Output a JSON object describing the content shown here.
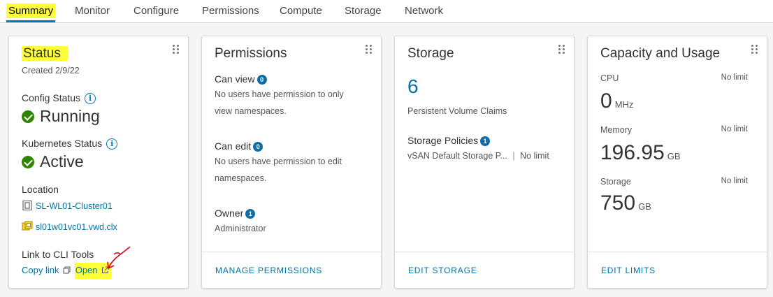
{
  "tabs": [
    "Summary",
    "Monitor",
    "Configure",
    "Permissions",
    "Compute",
    "Storage",
    "Network"
  ],
  "status": {
    "title": "Status",
    "created": "Created 2/9/22",
    "config_label": "Config Status",
    "config_value": "Running",
    "k8s_label": "Kubernetes Status",
    "k8s_value": "Active",
    "location_label": "Location",
    "cluster": "SL-WL01-Cluster01",
    "vcenter": "sl01w01vc01.vwd.clx",
    "cli_label": "Link to CLI Tools",
    "copy_link": "Copy link",
    "open": "Open"
  },
  "permissions": {
    "title": "Permissions",
    "can_view": "Can view",
    "can_view_count": "0",
    "can_view_line1": "No users have permission to only",
    "can_view_line2": "view namespaces.",
    "can_edit": "Can edit",
    "can_edit_count": "0",
    "can_edit_line1": "No users have permission to edit",
    "can_edit_line2": "namespaces.",
    "owner": "Owner",
    "owner_count": "1",
    "owner_value": "Administrator",
    "footer": "MANAGE PERMISSIONS"
  },
  "storage": {
    "title": "Storage",
    "pvc_count": "6",
    "pvc_label": "Persistent Volume Claims",
    "policies_label": "Storage Policies",
    "policies_count": "1",
    "policy_name": "vSAN Default Storage P...",
    "policy_sep": "|",
    "policy_limit": "No limit",
    "footer": "EDIT STORAGE"
  },
  "capacity": {
    "title": "Capacity and Usage",
    "cpu_label": "CPU",
    "cpu_limit": "No limit",
    "cpu_value": "0",
    "cpu_unit": "MHz",
    "mem_label": "Memory",
    "mem_limit": "No limit",
    "mem_value": "196.95",
    "mem_unit": "GB",
    "storage_label": "Storage",
    "storage_limit": "No limit",
    "storage_value": "750",
    "storage_unit": "GB",
    "footer": "EDIT LIMITS"
  },
  "colors": {
    "accent": "#0079b8",
    "link": "#0072a3",
    "highlight": "#ffff3a",
    "success": "#2f8400",
    "annotation": "#e0001a"
  },
  "icons": [
    "drag-handle-icon",
    "info-icon",
    "check-circle-icon",
    "cluster-icon",
    "vcenter-icon",
    "copy-icon",
    "external-link-icon",
    "annotation-arrow-icon"
  ]
}
